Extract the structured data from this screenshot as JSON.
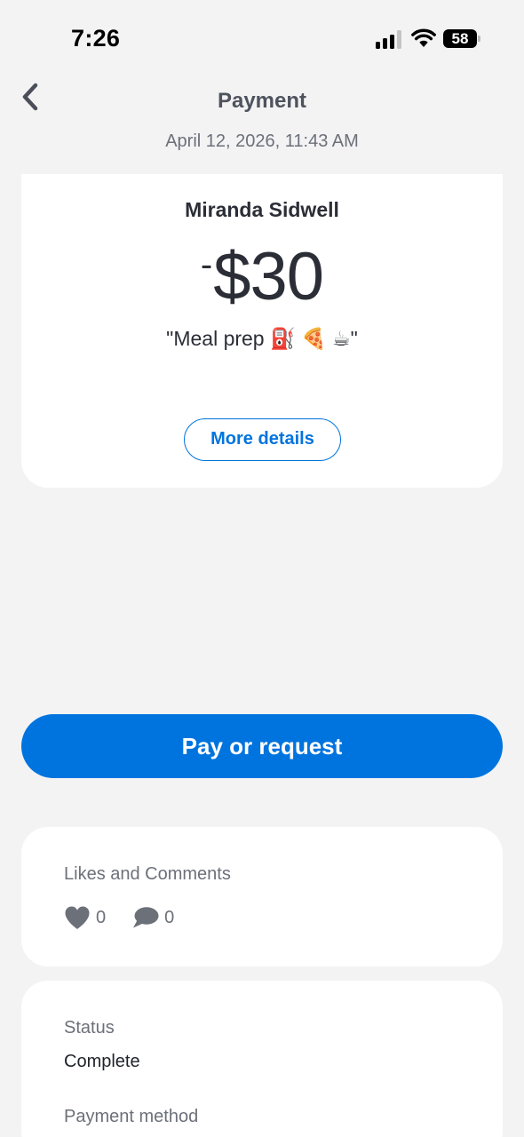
{
  "status_bar": {
    "time": "7:26",
    "battery_level": "58",
    "signal_bars_active": 3,
    "signal_bars_total": 4
  },
  "header": {
    "back_icon": "chevron-left-icon",
    "title": "Payment",
    "date": "April 12, 2026, 11:43 AM"
  },
  "payment": {
    "recipient": "Miranda Sidwell",
    "amount_sign": "-",
    "amount": "$30",
    "note": "\"Meal prep ⛽ 🍕 ☕\"",
    "more_details_label": "More details"
  },
  "actions": {
    "pay_or_request_label": "Pay or request"
  },
  "social": {
    "title": "Likes and Comments",
    "likes_count": "0",
    "comments_count": "0",
    "like_icon": "heart-icon",
    "comment_icon": "comment-bubble-icon"
  },
  "details": {
    "status_label": "Status",
    "status_value": "Complete",
    "payment_method_label": "Payment method"
  },
  "colors": {
    "accent": "#0074de",
    "background": "#f3f3f4",
    "card": "#ffffff",
    "text_primary": "#2b2e36",
    "text_secondary": "#6c7079"
  }
}
